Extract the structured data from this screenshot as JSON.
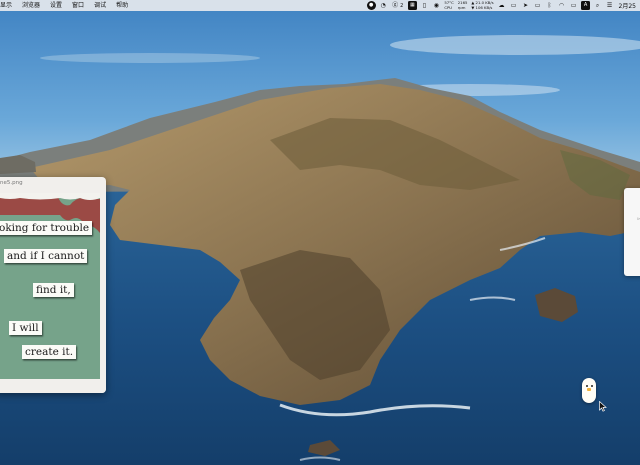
{
  "menubar": {
    "items": [
      "显示",
      "浏览器",
      "设置",
      "窗口",
      "调试",
      "帮助"
    ],
    "status": {
      "notif_count": "2",
      "temp": "57°C",
      "temp_label": "CPU",
      "rpm": "2165",
      "rpm_label": "rpm",
      "net_up": "▲ 21.0 KB/s",
      "net_down": "▼ 106 KB/s",
      "input_method": "A",
      "clock": "2月25"
    }
  },
  "preview_window": {
    "title": "ne5.png",
    "words": [
      "oking for trouble",
      "and if I cannot",
      "find it,",
      "I will",
      "create it."
    ]
  },
  "right_window": {
    "caret": "⊳"
  },
  "colors": {
    "sky": "#4f93cc",
    "sea": "#1b4d7e",
    "collage_green": "#76a38a",
    "collage_red": "#9b4a45"
  },
  "icons": [
    "menu-status-icons",
    "wifi-icon",
    "bluetooth-icon",
    "battery-icon",
    "search-icon",
    "control-center-icon",
    "mouse-pointer-icon"
  ]
}
